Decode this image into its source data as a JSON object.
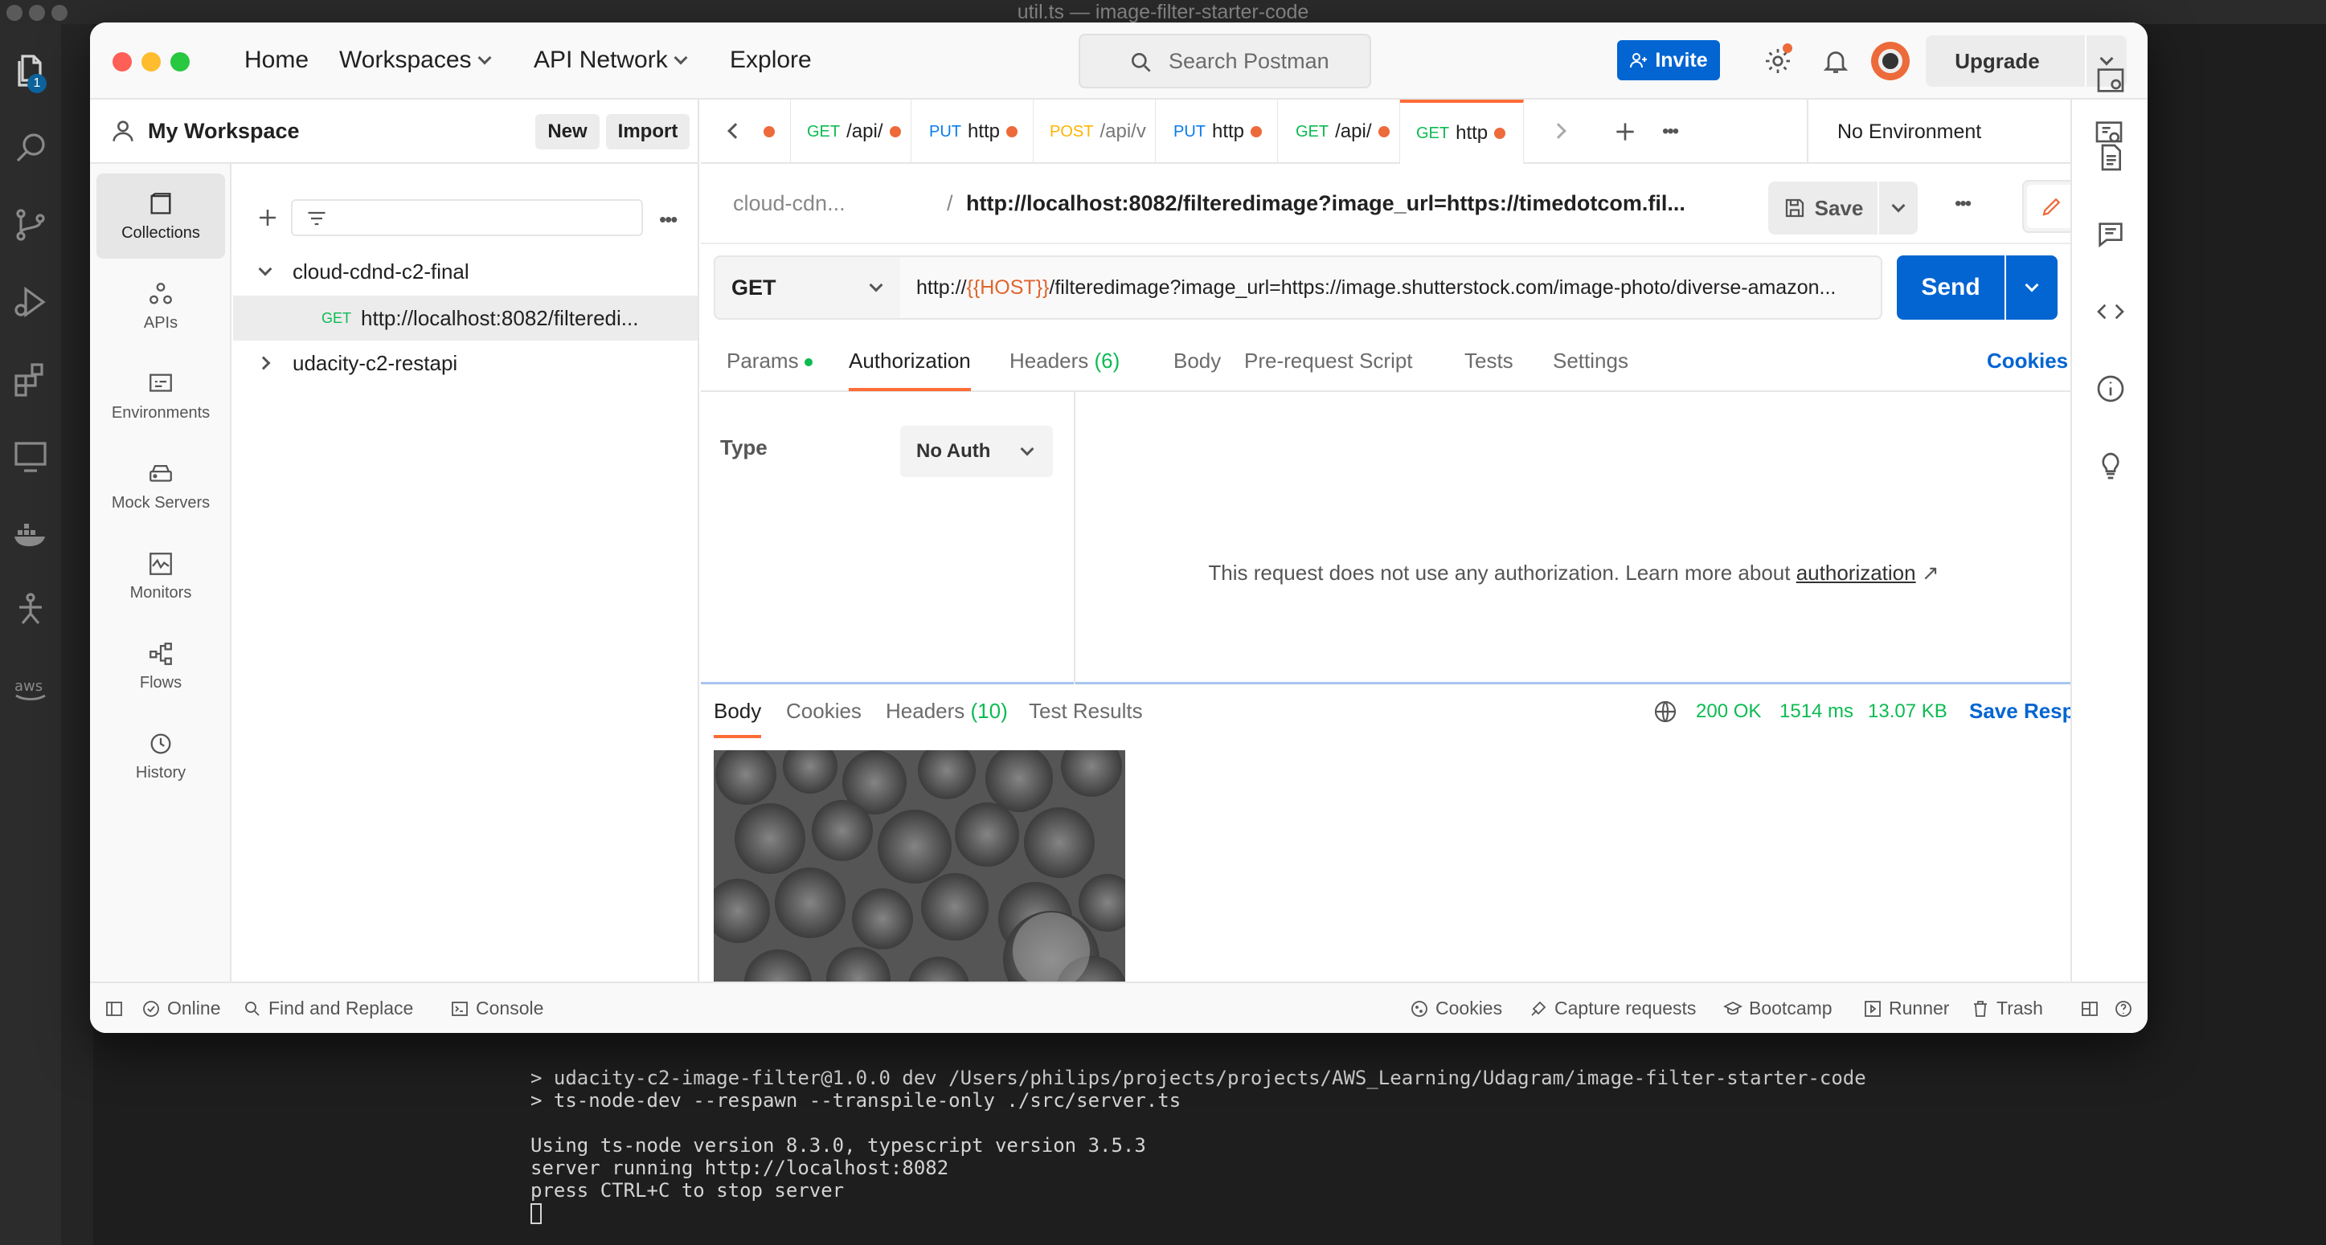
{
  "vscode": {
    "window_title": "util.ts — image-filter-starter-code",
    "badge": "1",
    "terminal_lines": [
      "> udacity-c2-image-filter@1.0.0 dev /Users/philips/projects/projects/AWS_Learning/Udagram/image-filter-starter-code",
      "> ts-node-dev --respawn --transpile-only ./src/server.ts",
      "",
      "Using ts-node version 8.3.0, typescript version 3.5.3",
      "server running http://localhost:8082",
      "press CTRL+C to stop server"
    ],
    "activity_icons": [
      "files-icon",
      "search-icon",
      "source-control-icon",
      "run-debug-icon",
      "extensions-icon",
      "remote-explorer-icon",
      "docker-icon",
      "testing-icon",
      "aws-icon"
    ]
  },
  "header": {
    "nav": [
      "Home",
      "Workspaces",
      "API Network",
      "Explore"
    ],
    "search_placeholder": "Search Postman",
    "invite": "Invite",
    "upgrade": "Upgrade"
  },
  "sidebar": {
    "workspace": "My Workspace",
    "new": "New",
    "import": "Import",
    "rail": [
      "Collections",
      "APIs",
      "Environments",
      "Mock Servers",
      "Monitors",
      "Flows",
      "History"
    ],
    "collections": [
      {
        "name": "cloud-cdnd-c2-final",
        "expanded": true
      },
      {
        "method": "GET",
        "name": "http://localhost:8082/filteredi..."
      },
      {
        "name": "udacity-c2-restapi",
        "expanded": false
      }
    ]
  },
  "tabs": [
    {
      "method": "",
      "label": ""
    },
    {
      "method": "GET",
      "label": "/api/"
    },
    {
      "method": "PUT",
      "label": "http"
    },
    {
      "method": "POST",
      "label": "/api/v"
    },
    {
      "method": "PUT",
      "label": "http"
    },
    {
      "method": "GET",
      "label": "/api/"
    },
    {
      "method": "GET",
      "label": "http"
    }
  ],
  "environment": "No Environment",
  "request": {
    "breadcrumb_collection": "cloud-cdn...",
    "breadcrumb_sep": "/",
    "title": "http://localhost:8082/filteredimage?image_url=https://timedotcom.fil...",
    "save": "Save",
    "method": "GET",
    "url_prefix": "http://",
    "url_var": "{{HOST}}",
    "url_rest": "/filteredimage?image_url=https://image.shutterstock.com/image-photo/diverse-amazon...",
    "send": "Send",
    "subtabs": [
      "Params",
      "Authorization",
      "Headers",
      "(6)",
      "Body",
      "Pre-request Script",
      "Tests",
      "Settings"
    ],
    "cookies": "Cookies",
    "auth": {
      "type_label": "Type",
      "type_value": "No Auth",
      "message": "This request does not use any authorization. Learn more about",
      "link": "authorization",
      "link_arrow": "↗"
    }
  },
  "response": {
    "tabs": [
      "Body",
      "Cookies",
      "Headers",
      "(10)",
      "Test Results"
    ],
    "status": "200 OK",
    "time": "1514 ms",
    "size": "13.07 KB",
    "save_response": "Save Response"
  },
  "statusbar": {
    "online": "Online",
    "find_replace": "Find and Replace",
    "console": "Console",
    "cookies": "Cookies",
    "capture": "Capture requests",
    "bootcamp": "Bootcamp",
    "runner": "Runner",
    "trash": "Trash"
  }
}
